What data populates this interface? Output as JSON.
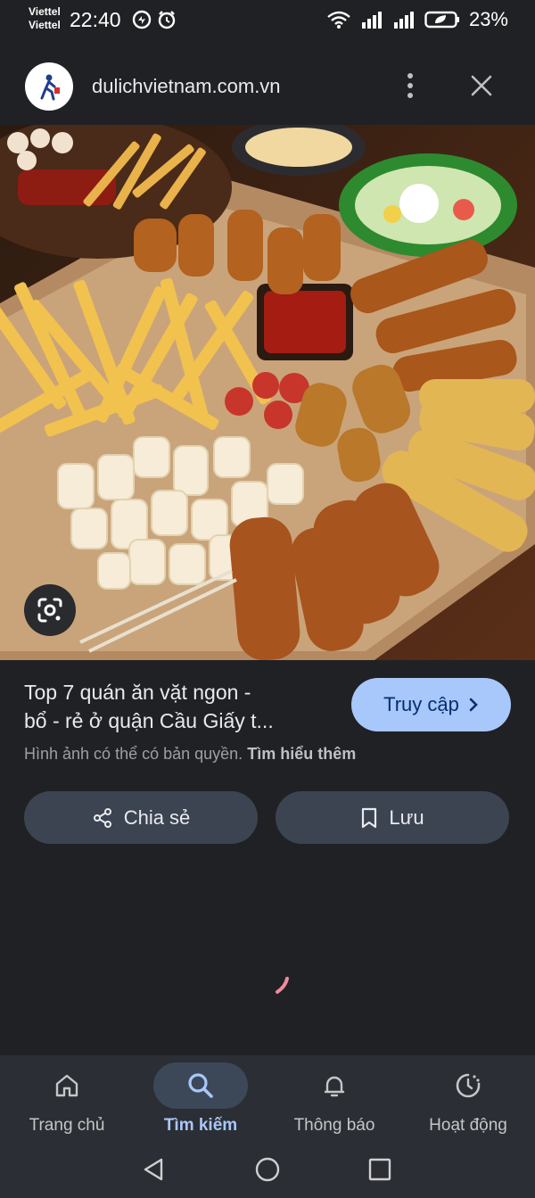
{
  "status_bar": {
    "carrier_1": "Viettel",
    "carrier_2": "Viettel",
    "time": "22:40",
    "battery": "23%"
  },
  "header": {
    "site": "dulichvietnam.com.vn",
    "more_icon": "more-vert-icon",
    "close_icon": "close-icon"
  },
  "result": {
    "title_line_1": "Top 7 quán ăn vặt ngon -",
    "title_line_2": "bổ - rẻ ở quận Cầu Giấy t...",
    "visit_label": "Truy cập",
    "copyright_text": "Hình ảnh có thể có bản quyền.",
    "learn_more": "Tìm hiểu thêm"
  },
  "actions": {
    "share_label": "Chia sẻ",
    "save_label": "Lưu"
  },
  "bottom_nav": {
    "items": [
      {
        "label": "Trang chủ",
        "icon": "home-icon",
        "active": false
      },
      {
        "label": "Tìm kiếm",
        "icon": "search-icon",
        "active": true
      },
      {
        "label": "Thông báo",
        "icon": "bell-icon",
        "active": false
      },
      {
        "label": "Hoạt động",
        "icon": "activity-icon",
        "active": false
      }
    ]
  },
  "colors": {
    "background": "#202124",
    "accent": "#a8c7fa",
    "button_bg": "#3c4452"
  }
}
